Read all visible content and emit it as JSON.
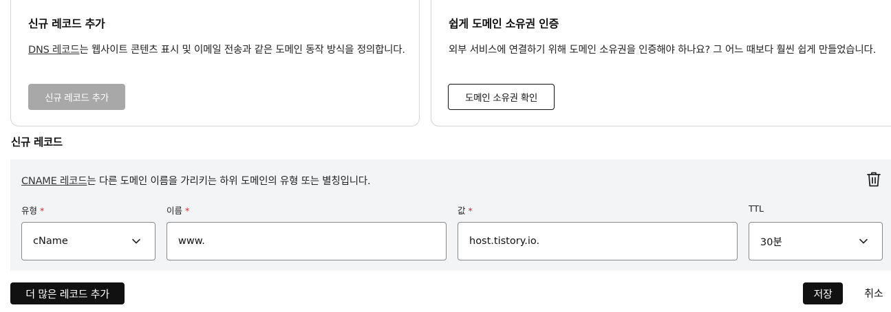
{
  "add_record_card": {
    "title": "신규 레코드 추가",
    "desc_link": "DNS 레코드",
    "desc_rest": "는 웹사이트 콘텐츠 표시 및 이메일 전송과 같은 도메인 동작 방식을 정의합니다.",
    "button_label": "신규 레코드 추가"
  },
  "verify_card": {
    "title": "쉽게 도메인 소유권 인증",
    "desc": "외부 서비스에 연결하기 위해 도메인 소유권을 인증해야 하나요? 그 어느 때보다 훨씬 쉽게 만들었습니다.",
    "button_label": "도메인 소유권 확인"
  },
  "new_record": {
    "section_title": "신규 레코드",
    "desc_link": "CNAME 레코드",
    "desc_rest": "는 다른 도메인 이름을 가리키는 하위 도메인의 유형 또는 별칭입니다.",
    "fields": {
      "type": {
        "label": "유형",
        "required_mark": "*",
        "value": "cName"
      },
      "name": {
        "label": "이름",
        "required_mark": "*",
        "value": "www."
      },
      "value": {
        "label": "값",
        "required_mark": "*",
        "value": "host.tistory.io."
      },
      "ttl": {
        "label": "TTL",
        "value": "30분"
      }
    },
    "icons": {
      "delete": "trash-icon",
      "dropdown": "chevron-down-icon"
    }
  },
  "footer": {
    "add_more_label": "더 많은 레코드 추가",
    "save_label": "저장",
    "cancel_label": "취소"
  },
  "colors": {
    "panel_bg": "#f3f4f5",
    "required": "#d9262c",
    "primary_button": "#111111",
    "disabled_button": "#a8a8a8"
  }
}
